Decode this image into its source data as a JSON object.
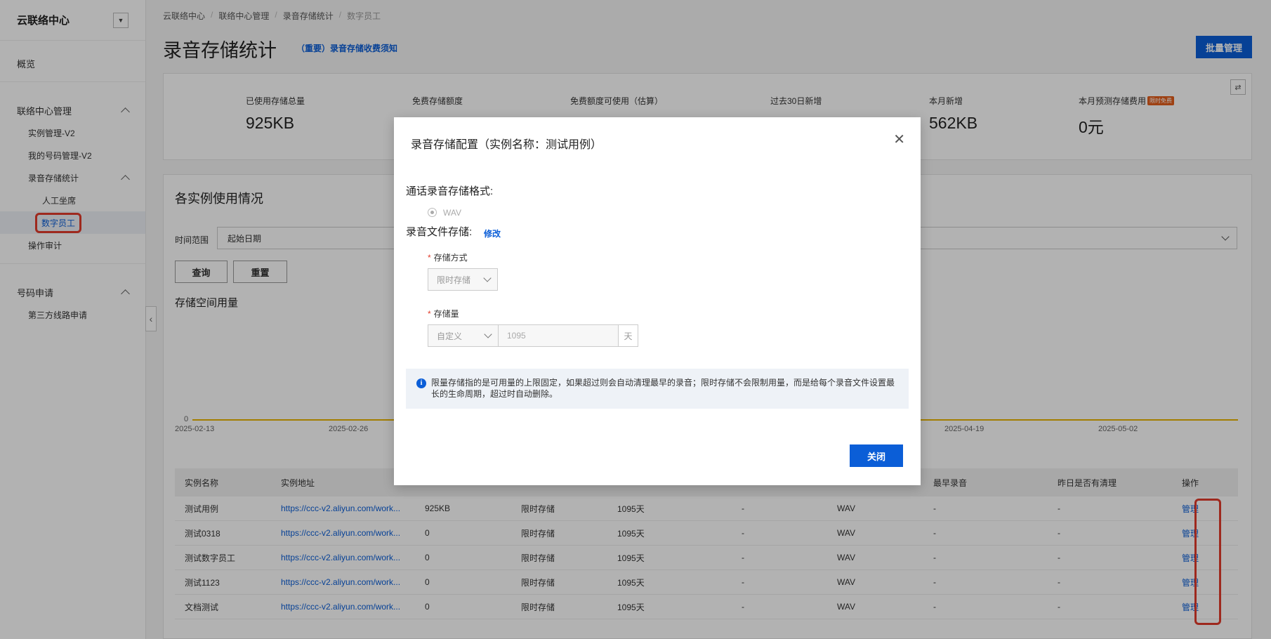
{
  "sidebar": {
    "title": "云联络中心",
    "overview": "概览",
    "group1": "联络中心管理",
    "instance_mgmt": "实例管理-V2",
    "number_mgmt": "我的号码管理-V2",
    "recording_stats": "录音存储统计",
    "human_agent": "人工坐席",
    "digital_employee": "数字员工",
    "audit": "操作审计",
    "group2": "号码申请",
    "third_party": "第三方线路申请"
  },
  "breadcrumb": [
    "云联络中心",
    "联络中心管理",
    "录音存储统计",
    "数字员工"
  ],
  "page": {
    "title": "录音存储统计",
    "notice_link": "（重要）录音存储收费须知",
    "batch_button": "批量管理"
  },
  "stats": {
    "used_total_label": "已使用存储总量",
    "used_total_value": "925KB",
    "free_quota_label": "免费存储额度",
    "free_usable_label": "免费额度可使用（估算）",
    "last30_label": "过去30日新增",
    "month_new_label": "本月新增",
    "month_new_value": "562KB",
    "forecast_label": "本月预测存储费用",
    "forecast_badge": "限时免费",
    "forecast_value": "0元"
  },
  "usage": {
    "title": "各实例使用情况",
    "range_label": "时间范围",
    "date_placeholder": "起始日期",
    "query_button": "查询",
    "reset_button": "重置",
    "chart_title": "存储空间用量",
    "y_zero": "0",
    "x_ticks": [
      "2025-02-13",
      "2025-02-26",
      "2025-04-19",
      "2025-05-02"
    ]
  },
  "table": {
    "headers": [
      "实例名称",
      "实例地址",
      "",
      "",
      "",
      "",
      "",
      "最早录音",
      "昨日是否有清理",
      "操作"
    ],
    "rows": [
      [
        "测试用例",
        "https://ccc-v2.aliyun.com/work...",
        "925KB",
        "限时存储",
        "1095天",
        "-",
        "WAV",
        "-",
        "-",
        "管理"
      ],
      [
        "测试0318",
        "https://ccc-v2.aliyun.com/work...",
        "0",
        "限时存储",
        "1095天",
        "-",
        "WAV",
        "-",
        "-",
        "管理"
      ],
      [
        "测试数字员工",
        "https://ccc-v2.aliyun.com/work...",
        "0",
        "限时存储",
        "1095天",
        "-",
        "WAV",
        "-",
        "-",
        "管理"
      ],
      [
        "测试1123",
        "https://ccc-v2.aliyun.com/work...",
        "0",
        "限时存储",
        "1095天",
        "-",
        "WAV",
        "-",
        "-",
        "管理"
      ],
      [
        "文档测试",
        "https://ccc-v2.aliyun.com/work...",
        "0",
        "限时存储",
        "1095天",
        "-",
        "WAV",
        "-",
        "-",
        "管理"
      ]
    ]
  },
  "dialog": {
    "title": "录音存储配置（实例名称：测试用例）",
    "format_label": "通话录音存储格式:",
    "format_option": "WAV",
    "file_label": "录音文件存储:",
    "modify_link": "修改",
    "storage_mode_label": "存储方式",
    "storage_mode_value": "限时存储",
    "storage_amount_label": "存储量",
    "storage_amount_type": "自定义",
    "storage_amount_value": "1095",
    "storage_unit": "天",
    "info_text": "限量存储指的是可用量的上限固定，如果超过则会自动清理最早的录音；限时存储不会限制用量，而是给每个录音文件设置最长的生命周期，超过时自动删除。",
    "close_button": "关闭"
  }
}
